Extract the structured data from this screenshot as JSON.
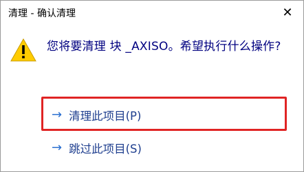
{
  "window": {
    "title": "清理 - 确认清理",
    "close_glyph": "✕"
  },
  "message": {
    "text": "您将要清理 块 _AXISO。希望执行什么操作?"
  },
  "options": [
    {
      "arrow": "→",
      "label": "清理此项目(P)",
      "highlighted": true
    },
    {
      "arrow": "→",
      "label": "跳过此项目(S)",
      "highlighted": false
    }
  ],
  "icons": {
    "warning": "warning-icon",
    "close": "close-icon",
    "arrow": "arrow-right-icon"
  },
  "colors": {
    "warning_fill": "#FFCC00",
    "highlight_border": "#E02424",
    "text_blue": "#000080",
    "link_blue": "#1F3F8F"
  }
}
